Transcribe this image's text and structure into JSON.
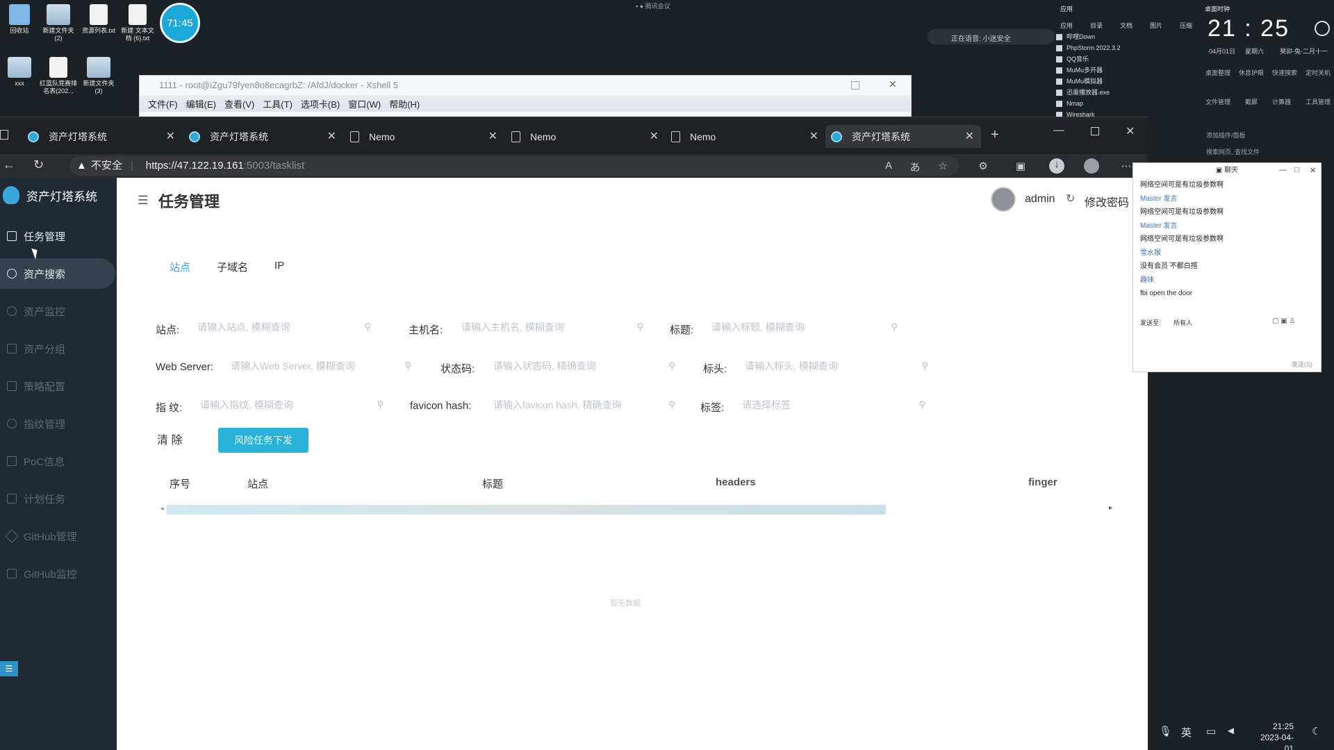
{
  "desktop": {
    "icons": [
      "回收站",
      "新建文件夹 (2)",
      "资源列表.txt",
      "新建 文本文档 (6).txt",
      "xxx",
      "红蓝队竞赛排名表(202...",
      "新建文件夹 (3)"
    ],
    "bubble_time": "71:45",
    "top_center_text": "腾讯会议",
    "voice_status": "正在语音: 小迷安全",
    "panel_header": "应用",
    "panel_categories": [
      "应用",
      "目录",
      "文档",
      "图片",
      "压缩"
    ],
    "app_list": [
      "哔哩Down",
      "PhpStorm 2022.3.2",
      "QQ音乐",
      "MuMu多开器",
      "MuMu模拟器",
      "迅雷播放器.exe",
      "Nmap",
      "Wireshark"
    ],
    "clock_title": "桌面时钟",
    "clock_time": "21 : 25",
    "clock_date": "04月01日",
    "clock_weekday": "星期六",
    "clock_lunar": "癸卯-兔-二月十一",
    "widgets_row1": [
      "桌面整理",
      "休息护眼",
      "快速搜索",
      "定时关机"
    ],
    "widgets_row2": [
      "文件管理",
      "截屏",
      "计算器",
      "工具管理"
    ],
    "add_widget": "添加插件/面板",
    "search_files": "搜索网页, 查找文件"
  },
  "xshell": {
    "title": "1111 - root@iZgu79fyen8o8ecagrbZ: /AfdJ/docker - Xshell 5",
    "menu": [
      "文件(F)",
      "编辑(E)",
      "查看(V)",
      "工具(T)",
      "选项卡(B)",
      "窗口(W)",
      "帮助(H)"
    ]
  },
  "browser": {
    "tabs": [
      "资产灯塔系统",
      "资产灯塔系统",
      "Nemo",
      "Nemo",
      "Nemo",
      "资产灯塔系统"
    ],
    "insecure_label": "不安全",
    "url_host": "https://47.122.19.161",
    "url_path": ":5003/tasklist"
  },
  "app": {
    "logo": "资产灯塔系统",
    "nav": [
      "任务管理",
      "资产搜索",
      "资产监控",
      "资产分组",
      "策略配置",
      "指纹管理",
      "PoC信息",
      "计划任务",
      "GitHub管理",
      "GitHub监控"
    ],
    "page_title": "任务管理",
    "user": "admin",
    "change_password": "修改密码",
    "subtabs": [
      "站点",
      "子域名",
      "IP"
    ],
    "filters": [
      {
        "label": "站点:",
        "placeholder": "请输入站点, 模糊查询"
      },
      {
        "label": "主机名:",
        "placeholder": "请输入主机名, 模糊查询"
      },
      {
        "label": "标题:",
        "placeholder": "请输入标题, 模糊查询"
      },
      {
        "label": "Web Server:",
        "placeholder": "请输入Web Server, 模糊查询"
      },
      {
        "label": "状态码:",
        "placeholder": "请输入状态码, 精确查询"
      },
      {
        "label": "标头:",
        "placeholder": "请输入标头, 模糊查询"
      },
      {
        "label": "指 纹:",
        "placeholder": "请输入指纹, 模糊查询"
      },
      {
        "label": "favicon hash:",
        "placeholder": "请输入favicon hash, 精确查询"
      },
      {
        "label": "标签:",
        "placeholder": "请选择标签"
      }
    ],
    "clear_button": "清 除",
    "risk_button": "风险任务下发",
    "table_headers": [
      "序号",
      "站点",
      "标题",
      "headers",
      "finger"
    ],
    "empty_text": "暂无数据"
  },
  "chat": {
    "title": "聊天",
    "messages": [
      {
        "text": "网络空间可是有垃圾参数啊",
        "type": "msg"
      },
      {
        "text": "Master 发言",
        "type": "name"
      },
      {
        "text": "网络空间可是有垃圾参数啊",
        "type": "msg"
      },
      {
        "text": "Master 发言",
        "type": "name"
      },
      {
        "text": "网络空间可是有垃圾参数啊",
        "type": "msg"
      },
      {
        "text": "雪水猴",
        "type": "name"
      },
      {
        "text": "没有会员 不都白搭",
        "type": "msg"
      },
      {
        "text": "趣味",
        "type": "name"
      },
      {
        "text": "fbi open the door",
        "type": "msg"
      }
    ],
    "send_to_label": "发送至:",
    "send_to_value": "所有人",
    "footer": "发送(S)"
  },
  "taskbar": {
    "ime": "英",
    "time": "21:25",
    "date": "2023-04-01"
  },
  "colors": {
    "accent": "#29b3d8",
    "sidebar_bg": "#1f2a35",
    "link_blue": "#409eff"
  }
}
